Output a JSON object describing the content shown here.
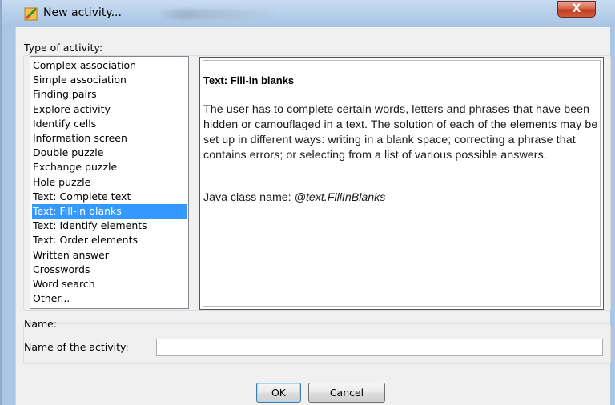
{
  "window": {
    "title": "New activity...",
    "close_label": "X"
  },
  "type_section": {
    "label": "Type of activity:"
  },
  "activity_list": {
    "items": [
      "Complex association",
      "Simple association",
      "Finding pairs",
      "Explore activity",
      "Identify cells",
      "Information screen",
      "Double puzzle",
      "Exchange puzzle",
      "Hole puzzle",
      "Text: Complete text",
      "Text: Fill-in blanks",
      "Text: Identify elements",
      "Text: Order elements",
      "Written answer",
      "Crosswords",
      "Word search",
      "Other..."
    ],
    "selected": "Text: Fill-in blanks"
  },
  "description": {
    "title": "Text: Fill-in blanks",
    "body": "The user has to complete certain words, letters and phrases that have been hidden or camouflaged in a text. The solution of each of the elements may be set up in different ways: writing in a blank space; correcting a phrase that contains errors; or selecting from a list of various possible answers.",
    "class_label": "Java class name: ",
    "class_name": "@text.FillInBlanks"
  },
  "name_section": {
    "label": "Name:",
    "field_label": "Name of the activity:",
    "field_value": ""
  },
  "buttons": {
    "ok": "OK",
    "cancel": "Cancel"
  },
  "colors": {
    "selection": "#3399ff",
    "close_button": "#c23c1f",
    "titlebar": "#b7cfea"
  }
}
